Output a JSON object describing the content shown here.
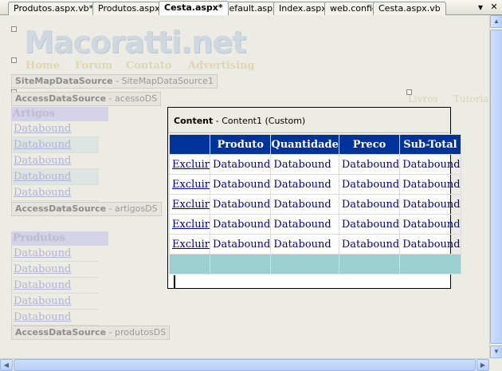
{
  "tabs": [
    {
      "label": "Produtos.aspx.vb*",
      "active": false
    },
    {
      "label": "Produtos.aspx*",
      "active": false
    },
    {
      "label": "Cesta.aspx*",
      "active": true
    },
    {
      "label": "Default.aspx",
      "active": false
    },
    {
      "label": "Index.aspx",
      "active": false
    },
    {
      "label": "web.config",
      "active": false
    },
    {
      "label": "Cesta.aspx.vb",
      "active": false
    }
  ],
  "tabbar": {
    "dropdown_icon": "▾",
    "close_icon": "✕"
  },
  "master": {
    "logo": "Macoratti.net",
    "nav": [
      "Home",
      "Forum",
      "Contato",
      "Advertising"
    ],
    "sitemap_ds": {
      "type": "SiteMapDataSource",
      "id": " - SiteMapDataSource1"
    },
    "acesso_ds": {
      "type": "AccessDataSource",
      "id": " - acessoDS"
    },
    "artigos_ds": {
      "type": "AccessDataSource",
      "id": " - artigosDS"
    },
    "produtos_ds": {
      "type": "AccessDataSource",
      "id": " - produtosDS"
    },
    "artigos_grid": {
      "header": "Artigos",
      "rows": [
        "Databound",
        "Databound",
        "Databound",
        "Databound",
        "Databound"
      ]
    },
    "produtos_grid": {
      "header": "Produtos",
      "rows": [
        "Databound",
        "Databound",
        "Databound",
        "Databound",
        "Databound"
      ]
    },
    "right_links": [
      "Livros",
      "Tutoriais"
    ]
  },
  "content": {
    "title": "Content",
    "subtitle": " - Content1 (Custom)",
    "grid": {
      "columns": [
        "",
        "Produto",
        "Quantidade",
        "Preco",
        "Sub-Total"
      ],
      "rows": [
        [
          "Excluir",
          "Databound",
          "Databound",
          "Databound",
          "Databound"
        ],
        [
          "Excluir",
          "Databound",
          "Databound",
          "Databound",
          "Databound"
        ],
        [
          "Excluir",
          "Databound",
          "Databound",
          "Databound",
          "Databound"
        ],
        [
          "Excluir",
          "Databound",
          "Databound",
          "Databound",
          "Databound"
        ],
        [
          "Excluir",
          "Databound",
          "Databound",
          "Databound",
          "Databound"
        ]
      ]
    }
  },
  "colors": {
    "header_bg": "#003399",
    "footer_bg": "#9ccfcf",
    "cell_text": "#000080"
  }
}
